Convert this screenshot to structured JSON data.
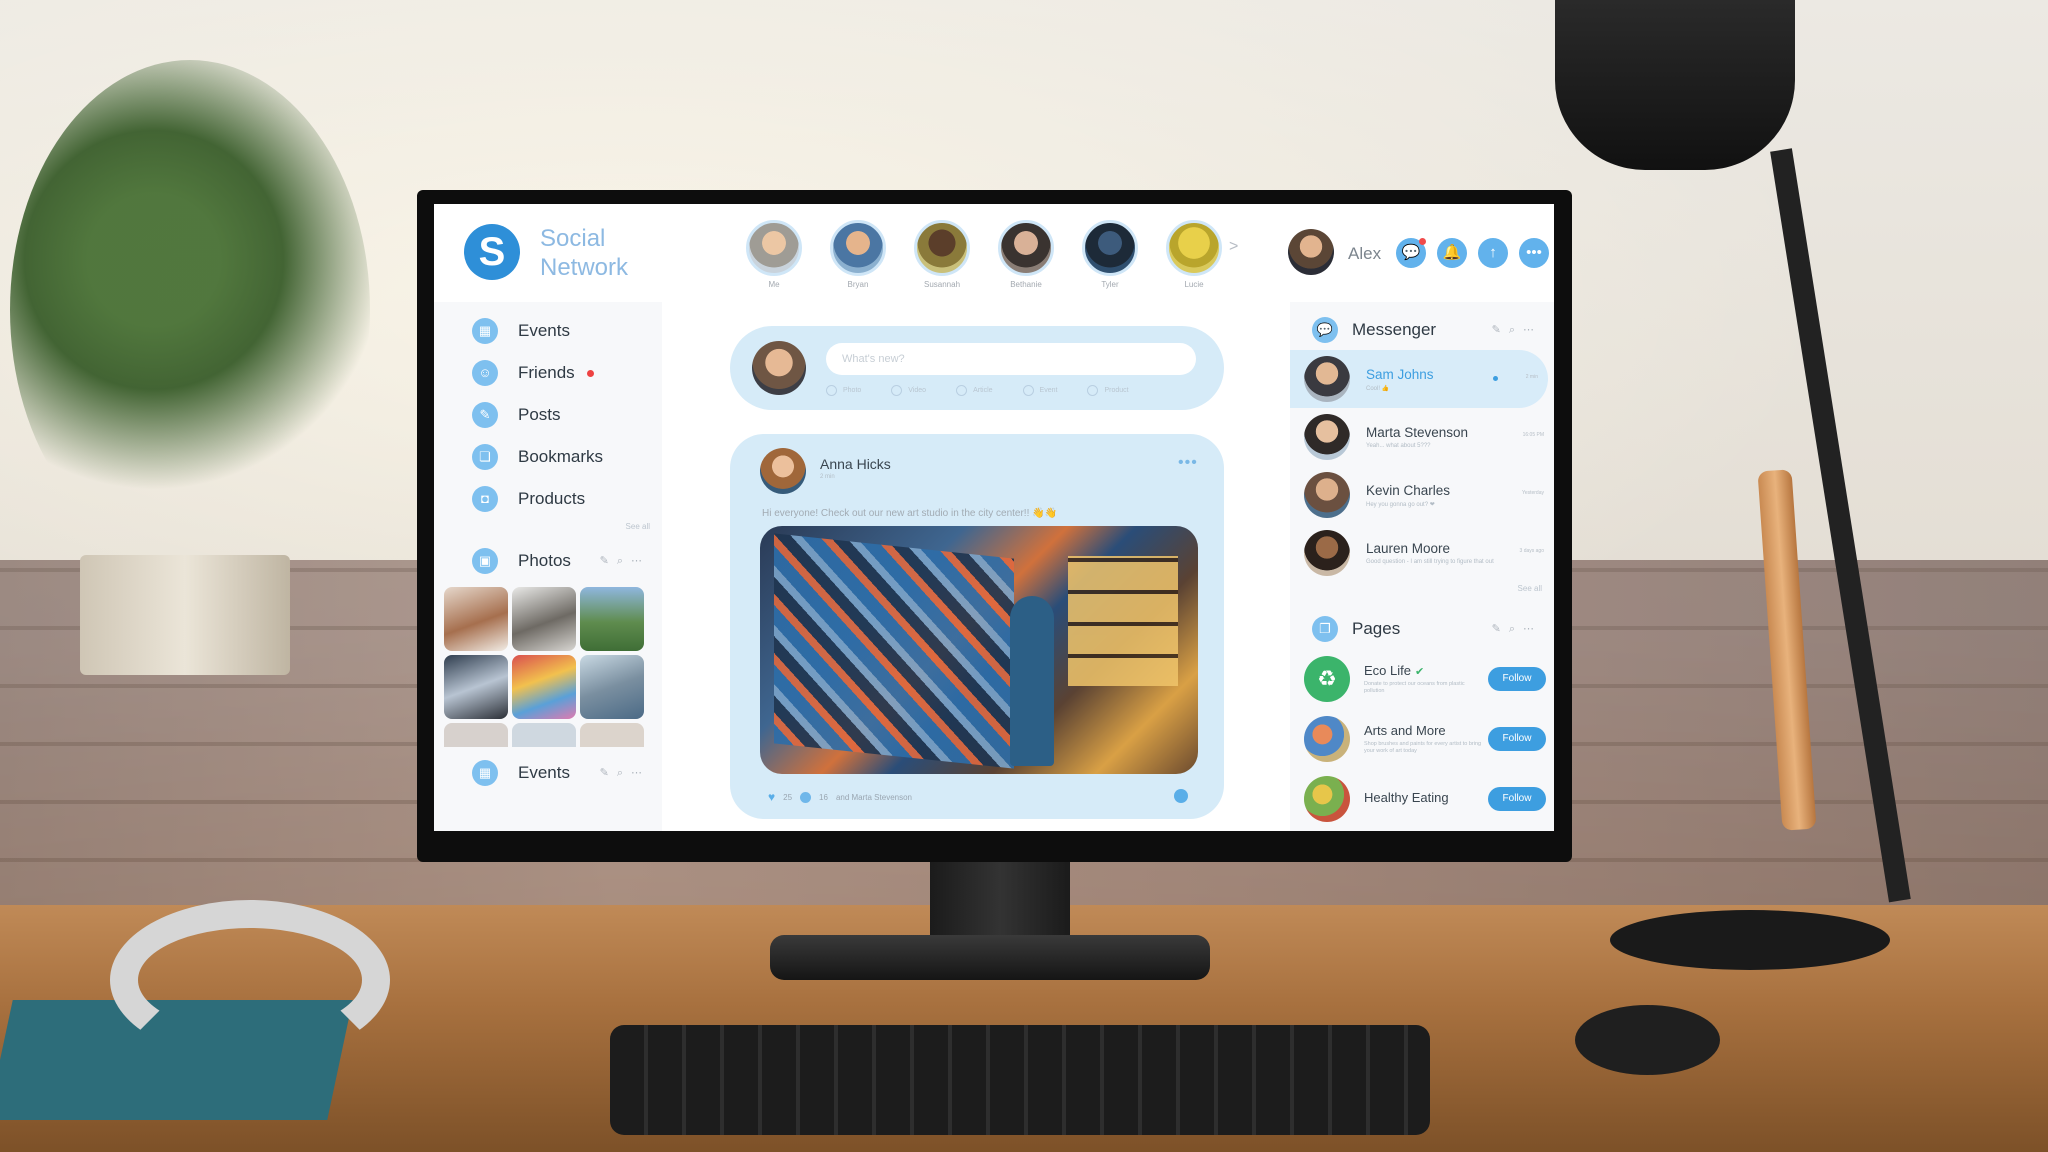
{
  "header": {
    "logo_letter": "S",
    "brand_line1": "Social",
    "brand_line2": "Network",
    "stories": [
      {
        "name": "Me"
      },
      {
        "name": "Bryan"
      },
      {
        "name": "Susannah"
      },
      {
        "name": "Bethanie"
      },
      {
        "name": "Tyler"
      },
      {
        "name": "Lucie"
      }
    ],
    "story_next": ">",
    "user_name": "Alex"
  },
  "sidebar": {
    "nav": [
      {
        "label": "Events"
      },
      {
        "label": "Friends"
      },
      {
        "label": "Posts"
      },
      {
        "label": "Bookmarks"
      },
      {
        "label": "Products"
      }
    ],
    "see_all": "See all",
    "photos_title": "Photos",
    "events_title": "Events"
  },
  "composer": {
    "placeholder": "What's new?",
    "actions": [
      "Photo",
      "Video",
      "Article",
      "Event",
      "Product"
    ]
  },
  "post": {
    "author": "Anna Hicks",
    "time": "2 min",
    "text": "Hi everyone! Check out our new art studio in the city center!! 👋👋",
    "likes": "25",
    "comments": "16",
    "comment_by": "and Marta Stevenson"
  },
  "messenger": {
    "title": "Messenger",
    "threads": [
      {
        "name": "Sam Johns",
        "preview": "Cool! 👍",
        "time": "2 min"
      },
      {
        "name": "Marta Stevenson",
        "preview": "Yeah... what about 5???",
        "time": "16:05 PM"
      },
      {
        "name": "Kevin Charles",
        "preview": "Hey you gonna go out? ❤",
        "time": "Yesterday"
      },
      {
        "name": "Lauren Moore",
        "preview": "Good question - I am still trying to figure that out",
        "time": "3 days ago"
      }
    ],
    "see_all": "See all"
  },
  "pages": {
    "title": "Pages",
    "items": [
      {
        "name": "Eco Life",
        "desc": "Donate to protect our oceans from plastic pollution",
        "button": "Follow"
      },
      {
        "name": "Arts and More",
        "desc": "Shop brushes and paints for every artist to bring your work of art today",
        "button": "Follow"
      },
      {
        "name": "Healthy Eating",
        "desc": "",
        "button": "Follow"
      }
    ]
  },
  "colors": {
    "accent": "#3d9ee0",
    "card_bg": "#d6ebf8",
    "notification": "#ee4242"
  }
}
